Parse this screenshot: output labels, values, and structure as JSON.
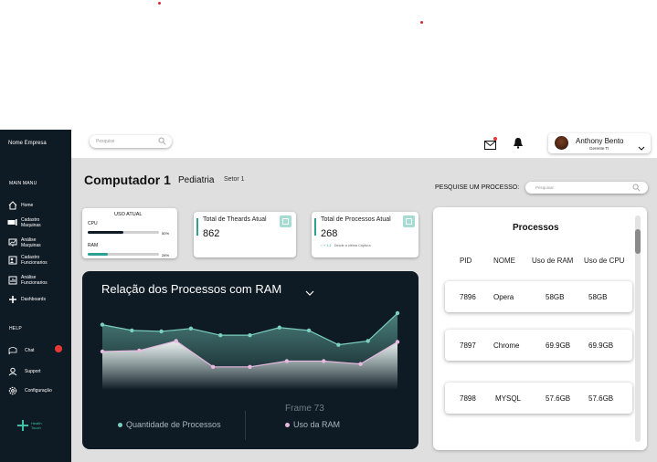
{
  "sidebar": {
    "company": "Nome Empresa",
    "main_menu": "MAIN MANU",
    "items": [
      {
        "label": "Home",
        "icon": "home-icon"
      },
      {
        "label": "Cadastro Maquinas",
        "icon": "machine-icon"
      },
      {
        "label": "Análise Maquinas",
        "icon": "analysis-icon"
      },
      {
        "label": "Cadastro Funcionarios",
        "icon": "employee-icon"
      },
      {
        "label": "Análise Funcionarios",
        "icon": "employee-analysis-icon"
      },
      {
        "label": "Dashboards",
        "icon": "plus-icon"
      }
    ],
    "help": "HELP",
    "help_items": [
      {
        "label": "Chat",
        "icon": "chat-icon"
      },
      {
        "label": "Support",
        "icon": "support-icon"
      },
      {
        "label": "Configuração",
        "icon": "gear-icon"
      }
    ],
    "logo": {
      "line1": "Health",
      "line2": "Touch"
    }
  },
  "header": {
    "search_placeholder": "Pesquise",
    "user_name": "Anthony Bento",
    "user_role": "Gerente TI"
  },
  "page": {
    "title": "Computador 1",
    "department": "Pediatria",
    "sector": "Setor 1"
  },
  "uso_atual": {
    "title": "USO ATUAL",
    "cpu_label": "CPU",
    "cpu_value": 0.5,
    "cpu_pct": "50%",
    "ram_label": "RAM",
    "ram_value": 0.28,
    "ram_pct": "28%"
  },
  "stats": {
    "threads_title": "Total de Theards Atual",
    "threads_value": "862",
    "processes_title": "Total de Processos Atual",
    "processes_value": "268",
    "processes_delta": "↑ + 1.2",
    "processes_delta_note": "Desde a última Captura"
  },
  "chart_data": {
    "type": "area",
    "title": "Relação dos Processos com RAM",
    "series": [
      {
        "name": "Quantidade de Processos",
        "color": "#7ad1c0",
        "values": [
          68,
          62,
          61,
          64,
          57,
          57,
          65,
          62,
          47,
          51,
          80
        ]
      },
      {
        "name": "Uso da RAM",
        "color": "#e7b8e0",
        "values": [
          40,
          41,
          51,
          24,
          24,
          30,
          30,
          27,
          50
        ]
      }
    ],
    "frame_label": "Frame 73"
  },
  "process_search": {
    "label": "PESQUISE UM PROCESSO:",
    "placeholder": "Pesquisar"
  },
  "processes": {
    "title": "Processos",
    "columns": [
      "PID",
      "NOME",
      "Uso de RAM",
      "Uso de CPU"
    ],
    "rows": [
      {
        "pid": "7896",
        "name": "Opera",
        "ram": "58GB",
        "cpu": "58GB"
      },
      {
        "pid": "7897",
        "name": "Chrome",
        "ram": "69.9GB",
        "cpu": "69.9GB"
      },
      {
        "pid": "7898",
        "name": "MYSQL",
        "ram": "57.6GB",
        "cpu": "57.6GB"
      }
    ]
  }
}
